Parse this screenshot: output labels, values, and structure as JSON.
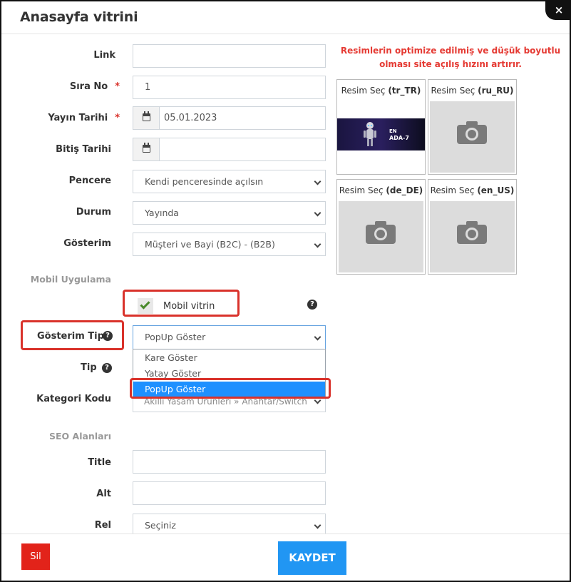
{
  "modal": {
    "title": "Anasayfa vitrini",
    "close_label": "×"
  },
  "form": {
    "link": {
      "label": "Link",
      "value": ""
    },
    "sira_no": {
      "label": "Sıra No",
      "required": "*",
      "value": "1"
    },
    "yayin_tarihi": {
      "label": "Yayın Tarihi",
      "required": "*",
      "value": "05.01.2023"
    },
    "bitis_tarihi": {
      "label": "Bitiş Tarihi",
      "value": ""
    },
    "pencere": {
      "label": "Pencere",
      "value": "Kendi penceresinde açılsın"
    },
    "durum": {
      "label": "Durum",
      "value": "Yayında"
    },
    "gosterim": {
      "label": "Gösterim",
      "value": "Müşteri ve Bayi (B2C) - (B2B)"
    },
    "mobil_section": "Mobil Uygulama",
    "mobil_vitrin": {
      "label": "Mobil vitrin",
      "checked": true
    },
    "gosterim_tipi": {
      "label": "Gösterim Tipi",
      "value": "PopUp Göster",
      "options": [
        "Kare Göster",
        "Yatay Göster",
        "PopUp Göster"
      ],
      "selected_index": 2
    },
    "tip": {
      "label": "Tip"
    },
    "kategori_kodu": {
      "label": "Kategori Kodu",
      "value": "Akıllı Yaşam Ürünleri » Anahtar/Switch"
    },
    "seo_section": "SEO Alanları",
    "title": {
      "label": "Title",
      "value": ""
    },
    "alt": {
      "label": "Alt",
      "value": ""
    },
    "rel": {
      "label": "Rel",
      "value": "Seçiniz"
    }
  },
  "images": {
    "warning_line1": "Resimlerin optimize edilmiş ve düşük boyutlu",
    "warning_line2": "olması site açılış hızını artırır.",
    "cards": [
      {
        "prefix": "Resim Seç ",
        "locale": "(tr_TR)",
        "has_image": true,
        "banner_text": "ADA-7"
      },
      {
        "prefix": "Resim Seç ",
        "locale": "(ru_RU)",
        "has_image": false
      },
      {
        "prefix": "Resim Seç ",
        "locale": "(de_DE)",
        "has_image": false
      },
      {
        "prefix": "Resim Seç ",
        "locale": "(en_US)",
        "has_image": false
      }
    ]
  },
  "footer": {
    "delete_label": "Sil",
    "save_label": "KAYDET"
  },
  "colors": {
    "accent": "#2196f3",
    "danger": "#e2231a",
    "highlight": "#d9322b",
    "selected_option": "#1e90ff"
  }
}
